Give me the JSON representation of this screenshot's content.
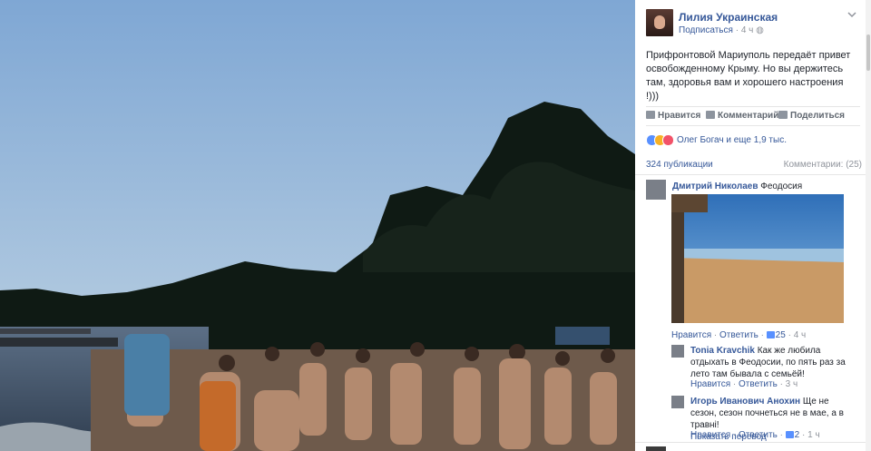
{
  "post": {
    "author": "Лилия Украинская",
    "follow": "Подписаться",
    "time": "4 ч",
    "text": "Прифронтовой Мариуполь передаёт привет освобожденному Крыму. Но вы держитесь там, здоровья вам и хорошего настроения !)))",
    "actions": {
      "like": "Нравится",
      "comment": "Комментарий",
      "share": "Поделиться"
    },
    "reactions_text": "Олег Богач и еще 1,9 тыс.",
    "shares": "324 публикации",
    "comments_count": "Комментарии: (25)"
  },
  "comments": [
    {
      "author": "Дмитрий Николаев",
      "text": "Феодосия",
      "like": "Нравится",
      "reply": "Ответить",
      "likes": "25",
      "time": "4 ч",
      "replies": [
        {
          "author": "Tonia Kravchik",
          "text": "Как же любила отдыхать в Феодосии, по пять раз за лето там бывала с семьёй!",
          "like": "Нравится",
          "reply": "Ответить",
          "time": "3 ч"
        },
        {
          "author": "Игорь Иванович Анохин",
          "text": "Ще не сезон, сезон почнеться не в мае, а в травні!",
          "translate": "Показать перевод",
          "like": "Нравится",
          "reply": "Ответить",
          "likes": "2",
          "time": "1 ч"
        }
      ]
    }
  ],
  "colors": {
    "link": "#365899",
    "muted": "#90949c",
    "like_blue": "#5890ff",
    "love_red": "#f25268",
    "haha_yellow": "#f7b125"
  },
  "icons": [
    "chevron-down-icon",
    "like-icon",
    "comment-icon",
    "share-icon",
    "like-reaction-icon",
    "haha-reaction-icon",
    "love-reaction-icon",
    "thumb-icon"
  ]
}
